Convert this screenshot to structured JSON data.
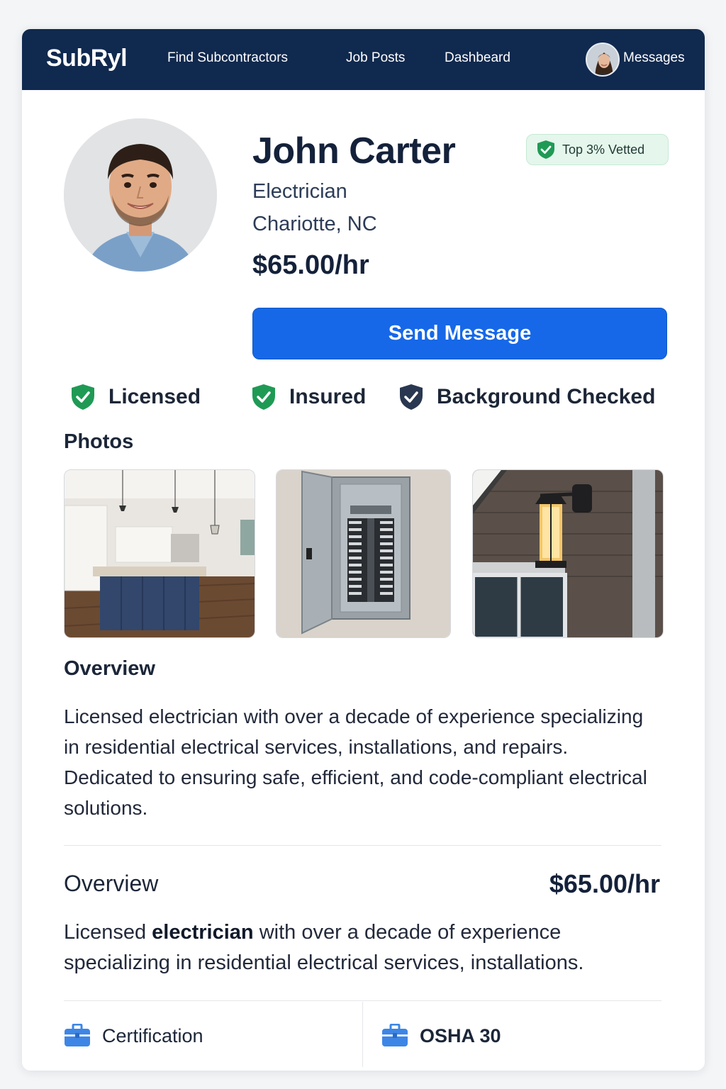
{
  "nav": {
    "logo": "SubRyl",
    "links": [
      "Find Subcontractors",
      "Job Posts",
      "Dashbeard"
    ],
    "messages": "Messages"
  },
  "profile": {
    "name": "John Carter",
    "trade": "Electrician",
    "location": "Chariotte, NC",
    "rate": "$65.00/hr",
    "badge": "Top 3% Vetted",
    "send_button": "Send Message"
  },
  "verifications": [
    {
      "label": "Licensed",
      "icon": "shield-check-icon",
      "color": "#1f9a55"
    },
    {
      "label": "Insured",
      "icon": "shield-check-icon",
      "color": "#1f9a55"
    },
    {
      "label": "Background Checked",
      "icon": "shield-check-icon",
      "color": "#2a3750"
    }
  ],
  "photos": {
    "title": "Photos",
    "items": [
      "kitchen-photo",
      "electrical-panel-photo",
      "outdoor-lantern-photo"
    ]
  },
  "overview": {
    "title": "Overview",
    "text": "Licensed electrician with over a decade of experience specializing in residential electrical services, installations, and repairs. Dedicated to ensuring safe, efficient, and code-compliant electrical solutions."
  },
  "overview2": {
    "title": "Overview",
    "rate": "$65.00/hr",
    "text_before": "Licensed ",
    "text_bold": "electrician",
    "text_after": " with over a decade of experience specializing in residential electrical services, installations."
  },
  "credentials": [
    {
      "label": "Certification",
      "icon": "briefcase-icon"
    },
    {
      "label": "OSHA 30",
      "icon": "briefcase-icon"
    }
  ],
  "colors": {
    "nav_bg": "#10294e",
    "accent": "#1668e8",
    "success": "#1f9a55",
    "badge_bg": "#e5f6ec",
    "icon_blue": "#3d86e6"
  }
}
